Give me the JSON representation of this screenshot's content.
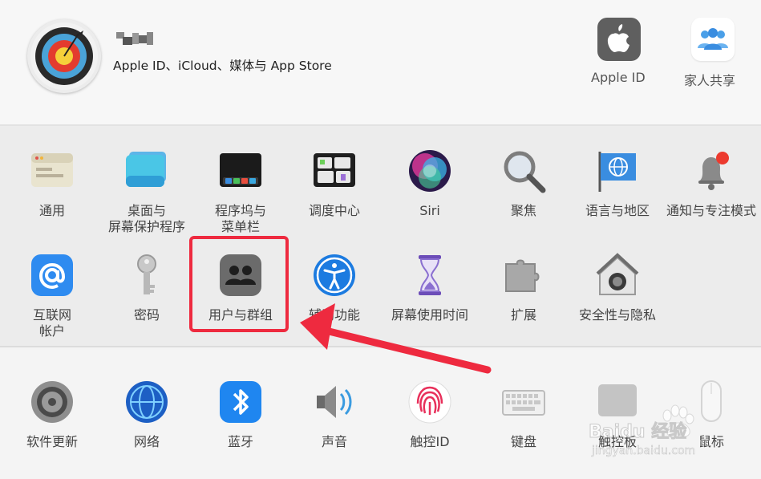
{
  "header": {
    "user_name": "",
    "user_subtitle": "Apple ID、iCloud、媒体与 App Store",
    "apple_id_label": "Apple ID",
    "family_label": "家人共享"
  },
  "prefs_row1": [
    {
      "id": "general",
      "label": "通用",
      "icon": "general-icon"
    },
    {
      "id": "desktop",
      "label": "桌面与\n屏幕保护程序",
      "icon": "desktop-icon"
    },
    {
      "id": "dock",
      "label": "程序坞与\n菜单栏",
      "icon": "dock-icon"
    },
    {
      "id": "mission",
      "label": "调度中心",
      "icon": "mission-control-icon"
    },
    {
      "id": "siri",
      "label": "Siri",
      "icon": "siri-icon"
    },
    {
      "id": "spotlight",
      "label": "聚焦",
      "icon": "magnifier-icon"
    },
    {
      "id": "language",
      "label": "语言与地区",
      "icon": "flag-globe-icon"
    },
    {
      "id": "notifications",
      "label": "通知与专注模式",
      "icon": "bell-icon"
    }
  ],
  "prefs_row2": [
    {
      "id": "internet",
      "label": "互联网\n帐户",
      "icon": "at-icon"
    },
    {
      "id": "password",
      "label": "密码",
      "icon": "key-icon"
    },
    {
      "id": "users",
      "label": "用户与群组",
      "icon": "users-icon"
    },
    {
      "id": "accessibility",
      "label": "辅助功能",
      "icon": "accessibility-icon"
    },
    {
      "id": "screentime",
      "label": "屏幕使用时间",
      "icon": "hourglass-icon"
    },
    {
      "id": "extensions",
      "label": "扩展",
      "icon": "puzzle-icon"
    },
    {
      "id": "security",
      "label": "安全性与隐私",
      "icon": "house-lock-icon"
    }
  ],
  "prefs_row3": [
    {
      "id": "software",
      "label": "软件更新",
      "icon": "gear-icon"
    },
    {
      "id": "network",
      "label": "网络",
      "icon": "globe-icon"
    },
    {
      "id": "bluetooth",
      "label": "蓝牙",
      "icon": "bluetooth-icon"
    },
    {
      "id": "sound",
      "label": "声音",
      "icon": "speaker-icon"
    },
    {
      "id": "touchid",
      "label": "触控ID",
      "icon": "fingerprint-icon"
    },
    {
      "id": "keyboard",
      "label": "键盘",
      "icon": "keyboard-icon"
    },
    {
      "id": "trackpad",
      "label": "触控板",
      "icon": "trackpad-icon"
    },
    {
      "id": "mouse",
      "label": "鼠标",
      "icon": "mouse-icon"
    }
  ],
  "watermark": {
    "brand": "Baidu 经验",
    "url": "jingyan.baidu.com"
  },
  "colors": {
    "highlight": "#ee2a3f",
    "arrow": "#ee2a3f"
  }
}
